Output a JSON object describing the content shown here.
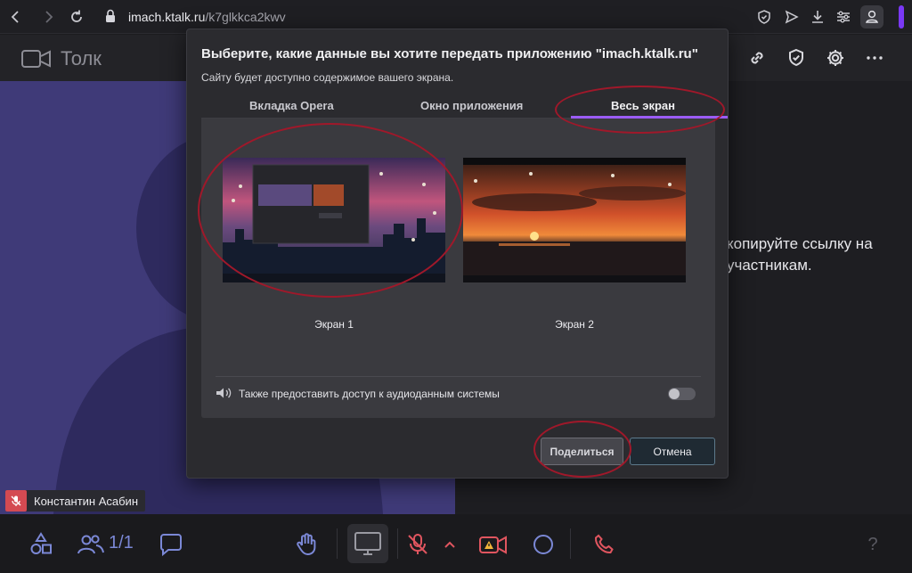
{
  "browser": {
    "url_host": "imach.ktalk.ru",
    "url_path": "/k7glkkca2kwv"
  },
  "app": {
    "brand": "Толк",
    "right_info_line1": "копируйте ссылку на",
    "right_info_line2": "участникам.",
    "participant_name": "Константин Асабин",
    "participants_count": "1/1"
  },
  "dialog": {
    "title": "Выберите, какие данные вы хотите передать приложению \"imach.ktalk.ru\"",
    "subtitle": "Сайту будет доступно содержимое вашего экрана.",
    "tabs": [
      {
        "label": "Вкладка Opera"
      },
      {
        "label": "Окно приложения"
      },
      {
        "label": "Весь экран"
      }
    ],
    "screens": [
      {
        "label": "Экран 1"
      },
      {
        "label": "Экран 2"
      }
    ],
    "audio_label": "Также предоставить доступ к аудиоданным системы",
    "share_button": "Поделиться",
    "cancel_button": "Отмена"
  },
  "toolbar": {
    "help": "?"
  },
  "colors": {
    "accent_purple": "#9b5cf5",
    "annotation_red": "#a0182a",
    "mic_off_red": "#d44a52",
    "toolbar_blue": "#7b88d6",
    "hangup_red": "#e0555f"
  }
}
